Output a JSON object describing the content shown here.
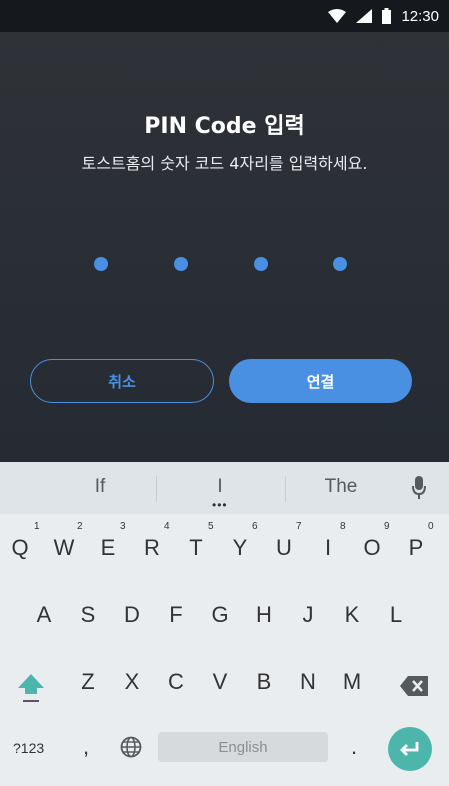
{
  "status_bar": {
    "time": "12:30",
    "icons": [
      "wifi-icon",
      "signal-icon",
      "battery-icon"
    ]
  },
  "dialog": {
    "title": "PIN Code 입력",
    "subtitle": "토스트홈의 숫자 코드 4자리를 입력하세요.",
    "pin_entered_count": 4,
    "pin_length": 4,
    "cancel_label": "취소",
    "connect_label": "연결",
    "accent_color": "#4a90e2"
  },
  "keyboard": {
    "suggestions": [
      "If",
      "I",
      "The"
    ],
    "row1": [
      {
        "key": "Q",
        "hint": "1"
      },
      {
        "key": "W",
        "hint": "2"
      },
      {
        "key": "E",
        "hint": "3"
      },
      {
        "key": "R",
        "hint": "4"
      },
      {
        "key": "T",
        "hint": "5"
      },
      {
        "key": "Y",
        "hint": "6"
      },
      {
        "key": "U",
        "hint": "7"
      },
      {
        "key": "I",
        "hint": "8"
      },
      {
        "key": "O",
        "hint": "9"
      },
      {
        "key": "P",
        "hint": "0"
      }
    ],
    "row2": [
      "A",
      "S",
      "D",
      "F",
      "G",
      "H",
      "J",
      "K",
      "L"
    ],
    "row3": [
      "Z",
      "X",
      "C",
      "V",
      "B",
      "N",
      "M"
    ],
    "symbols_key": "?123",
    "comma": ",",
    "period": ".",
    "space_label": "English",
    "enter_color": "#4db6ac",
    "shift_color": "#4db6ac"
  }
}
